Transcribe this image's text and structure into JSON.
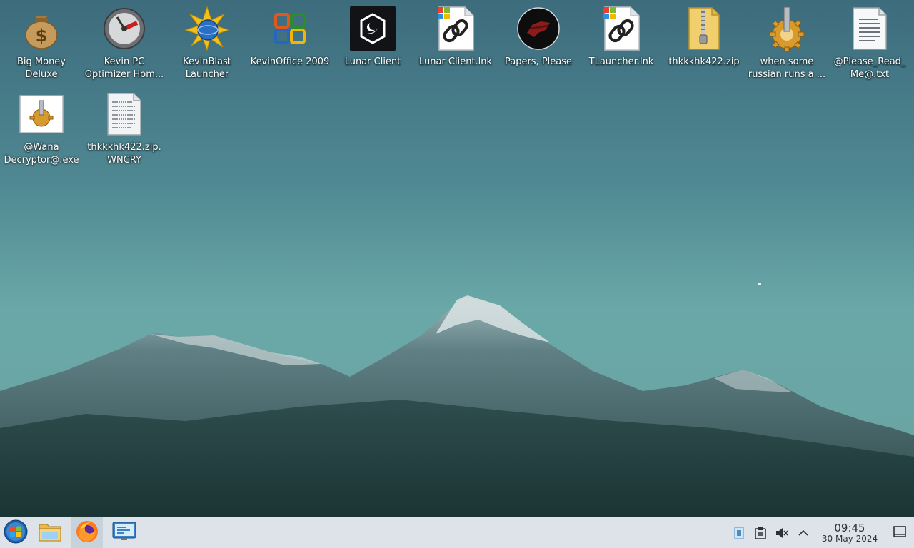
{
  "desktop": {
    "icons": [
      {
        "label": "Big Money Deluxe",
        "icon": "money-bag-icon"
      },
      {
        "label": "Kevin PC Optimizer Hom...",
        "icon": "speedometer-icon"
      },
      {
        "label": "KevinBlast Launcher",
        "icon": "starburst-globe-icon"
      },
      {
        "label": "KevinOffice 2009",
        "icon": "office-logo-icon"
      },
      {
        "label": "Lunar Client",
        "icon": "lunar-client-icon"
      },
      {
        "label": "Lunar Client.lnk",
        "icon": "shortcut-link-icon"
      },
      {
        "label": "Papers, Please",
        "icon": "papers-please-icon"
      },
      {
        "label": "TLauncher.lnk",
        "icon": "shortcut-link-icon"
      },
      {
        "label": "thkkkhk422.zip",
        "icon": "zip-folder-icon"
      },
      {
        "label": "when some russian runs a ...",
        "icon": "gear-icon"
      },
      {
        "label": "@Please_Read_Me@.txt",
        "icon": "text-file-icon"
      },
      {
        "label": "@Wana Decryptor@.exe",
        "icon": "exe-app-icon"
      },
      {
        "label": "thkkkhk422.zip.WNCRY",
        "icon": "binary-file-icon"
      }
    ]
  },
  "taskbar": {
    "start": {
      "icon": "start-orb-icon"
    },
    "pinned": [
      {
        "icon": "file-explorer-icon"
      },
      {
        "icon": "firefox-icon"
      },
      {
        "icon": "remote-desktop-icon"
      }
    ],
    "tray": {
      "icons": [
        "network-icon",
        "clipboard-icon",
        "speaker-muted-icon",
        "chevron-up-icon"
      ],
      "time": "09:45",
      "date": "30 May 2024",
      "show_desktop_icon": "show-desktop-icon"
    }
  }
}
